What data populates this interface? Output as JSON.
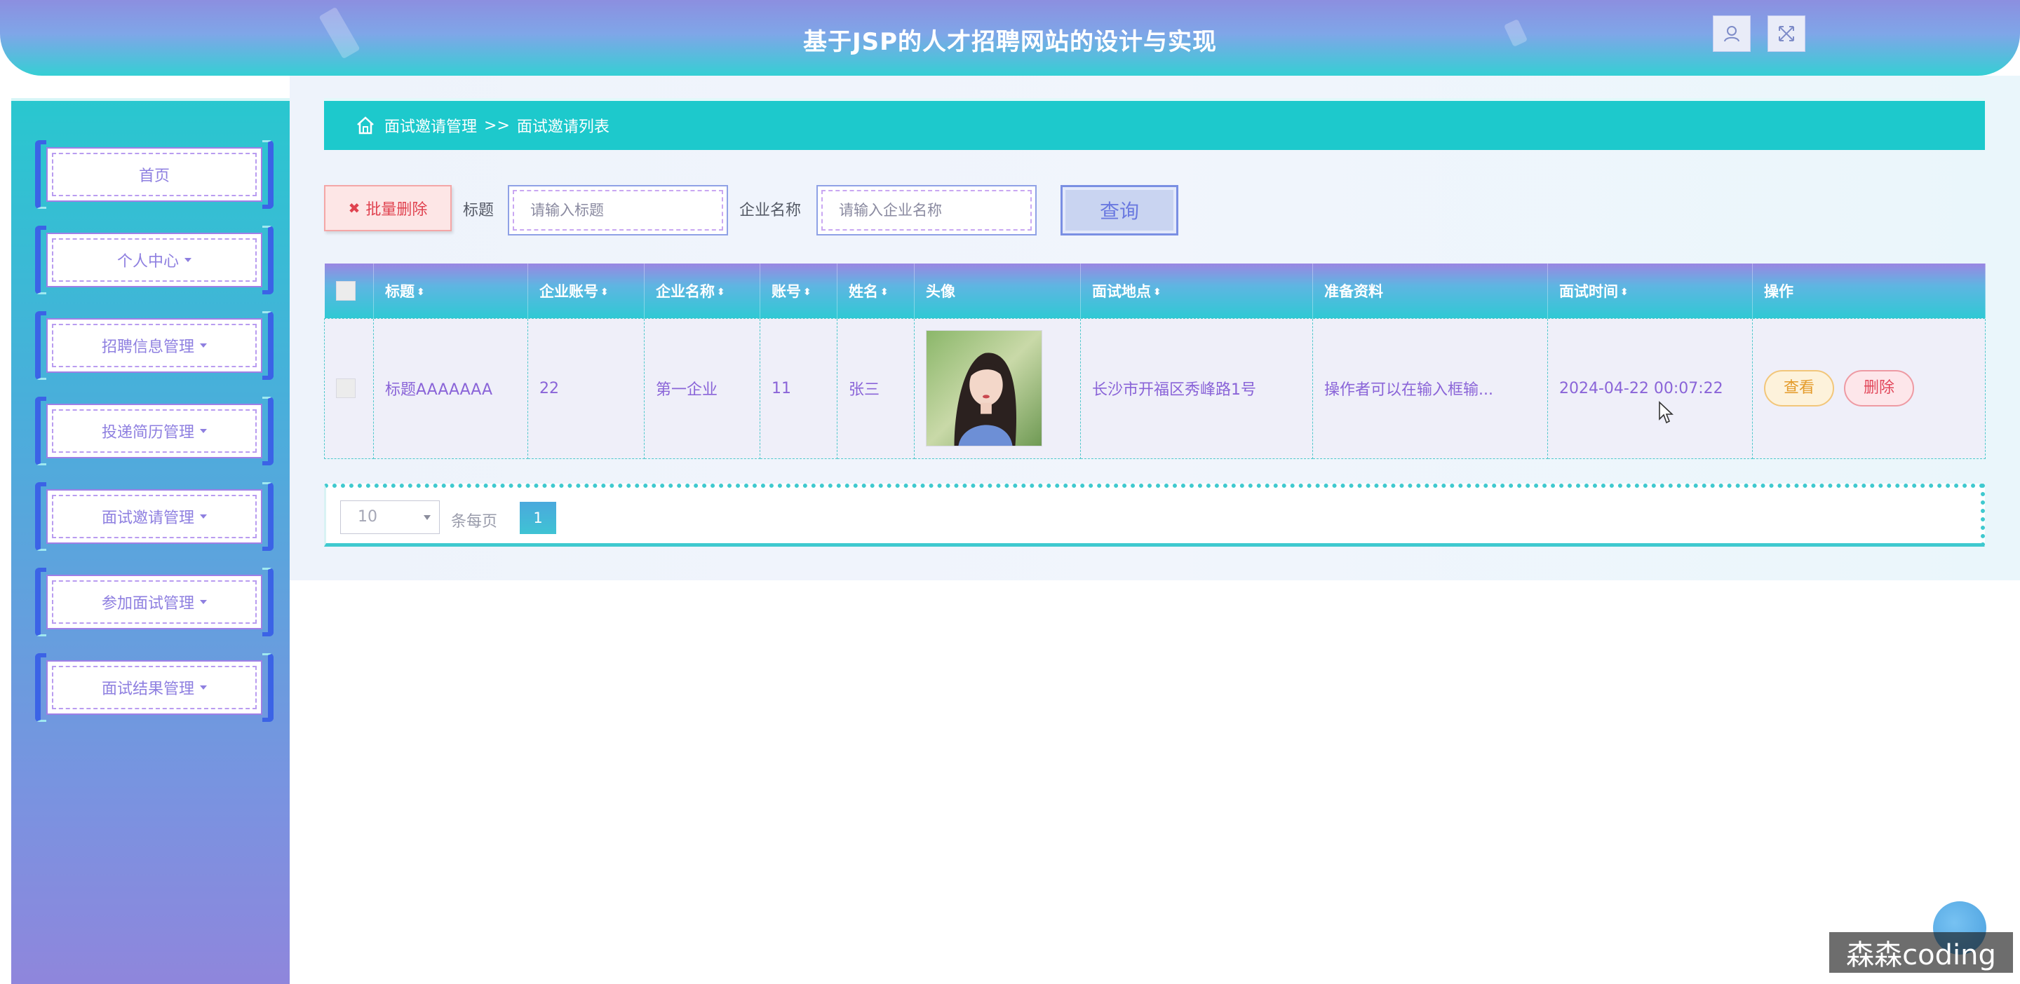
{
  "header": {
    "title": "基于JSP的人才招聘网站的设计与实现",
    "user_icon": "user-icon",
    "fullscreen_icon": "fullscreen-icon"
  },
  "sidebar": {
    "items": [
      {
        "label": "首页",
        "has_caret": false
      },
      {
        "label": "个人中心",
        "has_caret": true
      },
      {
        "label": "招聘信息管理",
        "has_caret": true
      },
      {
        "label": "投递简历管理",
        "has_caret": true
      },
      {
        "label": "面试邀请管理",
        "has_caret": true
      },
      {
        "label": "参加面试管理",
        "has_caret": true
      },
      {
        "label": "面试结果管理",
        "has_caret": true
      }
    ]
  },
  "breadcrumb": {
    "icon": "home-icon",
    "parent": "面试邀请管理",
    "separator": ">>",
    "current": "面试邀请列表"
  },
  "toolbar": {
    "batch_delete_icon": "✖",
    "batch_delete_label": "批量删除",
    "title_label": "标题",
    "title_placeholder": "请输入标题",
    "company_label": "企业名称",
    "company_placeholder": "请输入企业名称",
    "query_label": "查询"
  },
  "table": {
    "headers": {
      "title": "标题",
      "company_account": "企业账号",
      "company_name": "企业名称",
      "account": "账号",
      "name": "姓名",
      "avatar": "头像",
      "location": "面试地点",
      "materials": "准备资料",
      "time": "面试时间",
      "ops": "操作"
    },
    "sort_glyph": "⬍",
    "rows": [
      {
        "title": "标题AAAAAAA",
        "company_account": "22",
        "company_name": "第一企业",
        "account": "11",
        "name": "张三",
        "location": "长沙市开福区秀峰路1号",
        "materials": "操作者可以在输入框输...",
        "time": "2024-04-22 00:07:22",
        "view_label": "查看",
        "delete_label": "删除"
      }
    ]
  },
  "pagination": {
    "page_size": "10",
    "per_page_label": "条每页",
    "current_page": "1"
  },
  "watermark": "森森coding",
  "colors": {
    "primary_teal": "#1dc9cc",
    "purple": "#8e7fe0",
    "danger": "#e2475a",
    "warning": "#e49b2a"
  }
}
